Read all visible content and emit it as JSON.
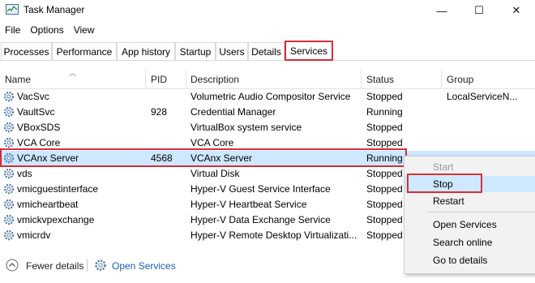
{
  "window": {
    "title": "Task Manager"
  },
  "controls": {
    "minimize": "—",
    "maximize": "☐",
    "close": "✕"
  },
  "menu": [
    "File",
    "Options",
    "View"
  ],
  "tabs": [
    "Processes",
    "Performance",
    "App history",
    "Startup",
    "Users",
    "Details",
    "Services"
  ],
  "active_tab": "Services",
  "columns": [
    "Name",
    "PID",
    "Description",
    "Status",
    "Group"
  ],
  "rows": [
    {
      "name": "VacSvc",
      "pid": "",
      "description": "Volumetric Audio Compositor Service",
      "status": "Stopped",
      "group": "LocalServiceN..."
    },
    {
      "name": "VaultSvc",
      "pid": "928",
      "description": "Credential Manager",
      "status": "Running",
      "group": ""
    },
    {
      "name": "VBoxSDS",
      "pid": "",
      "description": "VirtualBox system service",
      "status": "Stopped",
      "group": ""
    },
    {
      "name": "VCA Core",
      "pid": "",
      "description": "VCA Core",
      "status": "Stopped",
      "group": ""
    },
    {
      "name": "VCAnx Server",
      "pid": "4568",
      "description": "VCAnx Server",
      "status": "Running",
      "group": ""
    },
    {
      "name": "vds",
      "pid": "",
      "description": "Virtual Disk",
      "status": "Stopped",
      "group": ""
    },
    {
      "name": "vmicguestinterface",
      "pid": "",
      "description": "Hyper-V Guest Service Interface",
      "status": "Stopped",
      "group": ""
    },
    {
      "name": "vmicheartbeat",
      "pid": "",
      "description": "Hyper-V Heartbeat Service",
      "status": "Stopped",
      "group": ""
    },
    {
      "name": "vmickvpexchange",
      "pid": "",
      "description": "Hyper-V Data Exchange Service",
      "status": "Stopped",
      "group": ""
    },
    {
      "name": "vmicrdv",
      "pid": "",
      "description": "Hyper-V Remote Desktop Virtualizati...",
      "status": "Stopped",
      "group": ""
    }
  ],
  "selected_row": "VCAnx Server",
  "context_menu": {
    "start": "Start",
    "stop": "Stop",
    "restart": "Restart",
    "open_services": "Open Services",
    "search_online": "Search online",
    "go_to_details": "Go to details"
  },
  "footer": {
    "fewer_details": "Fewer details",
    "open_services": "Open Services"
  },
  "colors": {
    "highlight": "#d32f3b",
    "selection": "#cde8ff",
    "link": "#1a5fb4"
  }
}
